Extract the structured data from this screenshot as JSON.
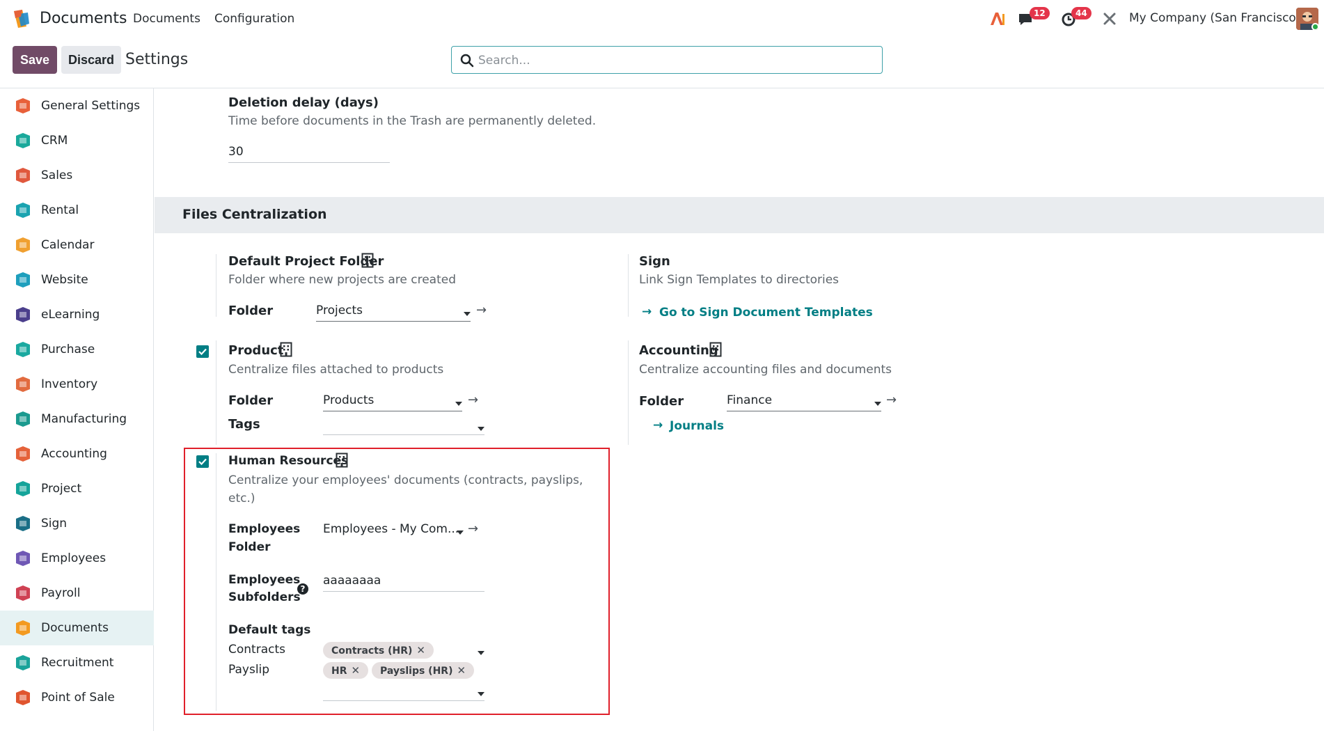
{
  "topbar": {
    "app_name": "Documents",
    "menu": [
      "Documents",
      "Configuration"
    ],
    "chat_badge": "12",
    "activity_badge": "44",
    "company": "My Company (San Francisco)"
  },
  "control": {
    "save_label": "Save",
    "discard_label": "Discard",
    "title": "Settings",
    "search_placeholder": "Search..."
  },
  "sidebar": {
    "items": [
      {
        "label": "General Settings",
        "icon": "general-settings-icon",
        "color": "#e8603a"
      },
      {
        "label": "CRM",
        "icon": "crm-icon",
        "color": "#1aa99b"
      },
      {
        "label": "Sales",
        "icon": "sales-icon",
        "color": "#e0583d"
      },
      {
        "label": "Rental",
        "icon": "rental-icon",
        "color": "#1aa3b0"
      },
      {
        "label": "Calendar",
        "icon": "calendar-icon",
        "color": "#f0a030"
      },
      {
        "label": "Website",
        "icon": "website-icon",
        "color": "#1e9fbd"
      },
      {
        "label": "eLearning",
        "icon": "elearning-icon",
        "color": "#4b3f8c"
      },
      {
        "label": "Purchase",
        "icon": "purchase-icon",
        "color": "#1aa9a0"
      },
      {
        "label": "Inventory",
        "icon": "inventory-icon",
        "color": "#e26b3f"
      },
      {
        "label": "Manufacturing",
        "icon": "manufacturing-icon",
        "color": "#1b9a8f"
      },
      {
        "label": "Accounting",
        "icon": "accounting-icon",
        "color": "#e5623a"
      },
      {
        "label": "Project",
        "icon": "project-icon",
        "color": "#15a49a"
      },
      {
        "label": "Sign",
        "icon": "sign-icon",
        "color": "#1a6e86"
      },
      {
        "label": "Employees",
        "icon": "employees-icon",
        "color": "#6f58b5"
      },
      {
        "label": "Payroll",
        "icon": "payroll-icon",
        "color": "#cf4153"
      },
      {
        "label": "Documents",
        "icon": "documents-icon",
        "color": "#f39a20"
      },
      {
        "label": "Recruitment",
        "icon": "recruitment-icon",
        "color": "#1aa39a"
      },
      {
        "label": "Point of Sale",
        "icon": "point-of-sale-icon",
        "color": "#e0552f"
      }
    ],
    "active_index": 15
  },
  "deletion": {
    "title": "Deletion delay (days)",
    "desc": "Time before documents in the Trash are permanently deleted.",
    "value": "30"
  },
  "section": {
    "title": "Files Centralization"
  },
  "project": {
    "title": "Default Project Folder",
    "desc": "Folder where new projects are created",
    "folder_label": "Folder",
    "folder_value": "Projects"
  },
  "sign": {
    "title": "Sign",
    "desc": "Link Sign Templates to directories",
    "link": "Go to Sign Document Templates"
  },
  "product": {
    "checked": true,
    "title": "Product",
    "desc": "Centralize files attached to products",
    "folder_label": "Folder",
    "folder_value": "Products",
    "tags_label": "Tags"
  },
  "accounting": {
    "title": "Accounting",
    "desc": "Centralize accounting files and documents",
    "folder_label": "Folder",
    "folder_value": "Finance",
    "journals_link": "Journals"
  },
  "hr": {
    "checked": true,
    "title": "Human Resources",
    "desc_line1": "Centralize your employees' documents (contracts, payslips,",
    "desc_line2": "etc.)",
    "emp_folder_label1": "Employees",
    "emp_folder_label2": "Folder",
    "emp_folder_value": "Employees - My Com...",
    "subfolders_label1": "Employees",
    "subfolders_label2": "Subfolders",
    "subfolders_value": "aaaaaaaa",
    "default_tags_label": "Default tags",
    "contracts_label": "Contracts",
    "contracts_tags": [
      "Contracts (HR)"
    ],
    "payslip_label": "Payslip",
    "payslip_tags": [
      "HR",
      "Payslips (HR)"
    ]
  }
}
